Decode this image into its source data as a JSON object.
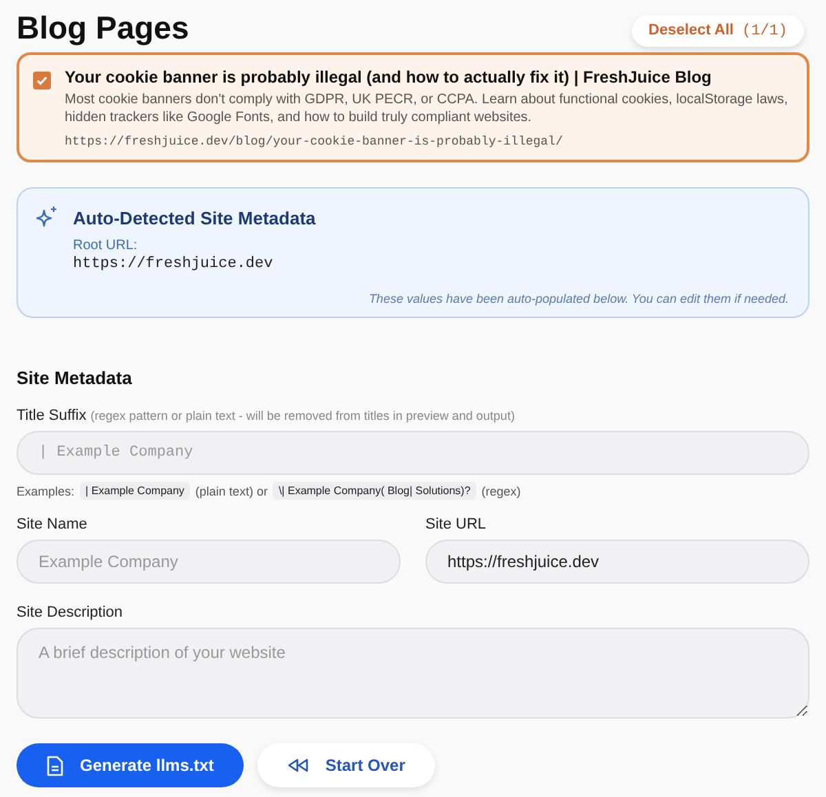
{
  "header": {
    "title": "Blog Pages",
    "deselect_button": {
      "label": "Deselect All",
      "count": "(1/1)"
    }
  },
  "pages": [
    {
      "title": "Your cookie banner is probably illegal (and how to actually fix it) | FreshJuice Blog",
      "description": "Most cookie banners don't comply with GDPR, UK PECR, or CCPA. Learn about functional cookies, localStorage laws, hidden trackers like Google Fonts, and how to build truly compliant websites.",
      "url": "https://freshjuice.dev/blog/your-cookie-banner-is-probably-illegal/",
      "checked": true
    }
  ],
  "detected": {
    "title": "Auto-Detected Site Metadata",
    "root_label": "Root URL:",
    "root_url": "https://freshjuice.dev",
    "note": "These values have been auto-populated below. You can edit them if needed."
  },
  "metadata": {
    "heading": "Site Metadata",
    "title_suffix": {
      "label": "Title Suffix",
      "hint": "(regex pattern or plain text - will be removed from titles in preview and output)",
      "placeholder": "| Example Company"
    },
    "examples": [
      {
        "kind": "text",
        "text": "Examples:"
      },
      {
        "kind": "code",
        "text": "| Example Company"
      },
      {
        "kind": "text",
        "text": "(plain text) or"
      },
      {
        "kind": "code",
        "text": "\\| Example Company( Blog| Solutions)?"
      },
      {
        "kind": "text",
        "text": "(regex)"
      }
    ],
    "site_name": {
      "label": "Site Name",
      "placeholder": "Example Company"
    },
    "site_url": {
      "label": "Site URL",
      "value": "https://freshjuice.dev"
    },
    "site_description": {
      "label": "Site Description",
      "placeholder": "A brief description of your website"
    }
  },
  "actions": [
    {
      "kind": "primary",
      "label": "Generate llms.txt"
    },
    {
      "kind": "secondary",
      "label": "Start Over"
    }
  ]
}
